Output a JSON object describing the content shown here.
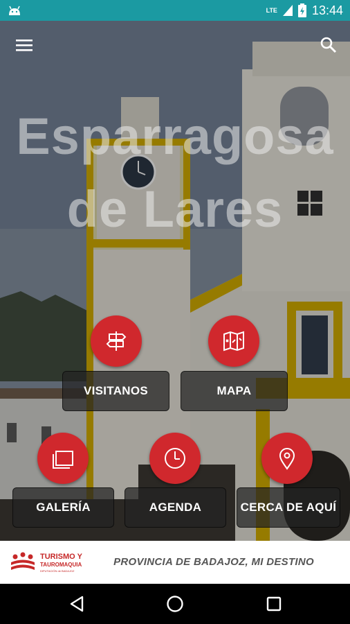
{
  "status_bar": {
    "time": "13:44",
    "network": "LTE",
    "icons": [
      "android-icon",
      "lte-signal-icon",
      "battery-icon"
    ]
  },
  "header": {
    "menu_icon": "hamburger-menu-icon",
    "search_icon": "search-icon"
  },
  "hero": {
    "title_line1": "Esparragosa",
    "title_line2": "de Lares",
    "background": "photo of white and yellow church tower"
  },
  "tiles": [
    {
      "label": "VISITANOS",
      "icon": "signpost-icon"
    },
    {
      "label": "MAPA",
      "icon": "map-icon"
    },
    {
      "label": "GALERÍA",
      "icon": "gallery-icon"
    },
    {
      "label": "AGENDA",
      "icon": "clock-icon"
    },
    {
      "label": "CERCA DE AQUÍ",
      "icon": "location-pin-icon"
    }
  ],
  "footer": {
    "logo_line1": "TURISMO Y",
    "logo_line2": "TAUROMAQUIA",
    "logo_small": "DIPUTACIÓN de BADAJOZ",
    "slogan": "PROVINCIA DE BADAJOZ, MI DESTINO"
  },
  "nav_bar": {
    "back_icon": "back-triangle-icon",
    "home_icon": "home-circle-icon",
    "recents_icon": "recents-square-icon"
  },
  "colors": {
    "status_bar": "#1b9aa2",
    "accent_red": "#d0282d",
    "tile_bg": "#232323"
  }
}
